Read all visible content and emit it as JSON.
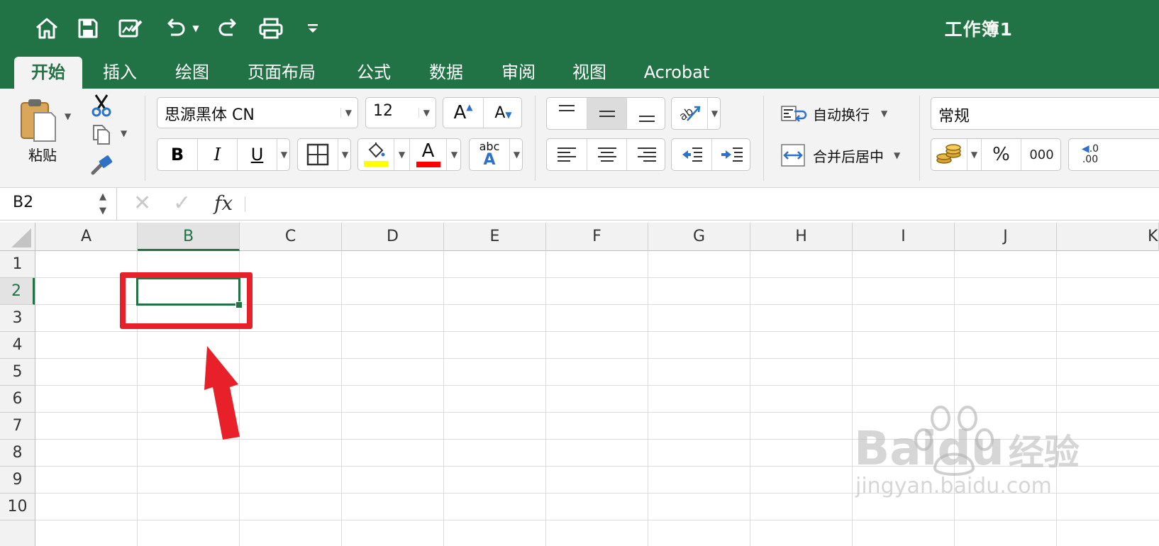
{
  "window": {
    "workbook_title": "工作簿1"
  },
  "quick_access": [
    {
      "name": "home-icon"
    },
    {
      "name": "save-icon"
    },
    {
      "name": "edit-icon"
    },
    {
      "name": "undo-icon"
    },
    {
      "name": "redo-icon"
    },
    {
      "name": "print-icon"
    },
    {
      "name": "customize-icon"
    }
  ],
  "tabs": [
    {
      "label": "开始",
      "active": true
    },
    {
      "label": "插入"
    },
    {
      "label": "绘图"
    },
    {
      "label": "页面布局"
    },
    {
      "label": "公式"
    },
    {
      "label": "数据"
    },
    {
      "label": "审阅"
    },
    {
      "label": "视图"
    },
    {
      "label": "Acrobat"
    }
  ],
  "ribbon": {
    "paste_label": "粘贴",
    "font_name": "思源黑体 CN",
    "font_size": "12",
    "bold": "B",
    "italic": "I",
    "underline": "U",
    "font_color_glyph": "A",
    "abc_label": "abc",
    "wrap_text": "自动换行",
    "merge_center": "合并后居中",
    "number_format": "常规",
    "percent": "%",
    "thousands": "000",
    "decimal_top": ".0",
    "decimal_bottom": ".00",
    "highlight_color": "#FFFF00",
    "font_color": "#FF0000"
  },
  "formula_bar": {
    "cell_ref": "B2",
    "fx": "fx",
    "content": ""
  },
  "grid": {
    "columns": [
      "A",
      "B",
      "C",
      "D",
      "E",
      "F",
      "G",
      "H",
      "I",
      "J",
      "K"
    ],
    "rows": [
      "1",
      "2",
      "3",
      "4",
      "5",
      "6",
      "7",
      "8",
      "9",
      "10"
    ],
    "selected_column": "B",
    "selected_row": "2",
    "accent": "#217346"
  },
  "annotation": {
    "color": "#E8202A"
  },
  "watermark": {
    "brand": "Bai",
    "brand_du": "du",
    "cn": "经验",
    "url": "jingyan.baidu.com"
  }
}
